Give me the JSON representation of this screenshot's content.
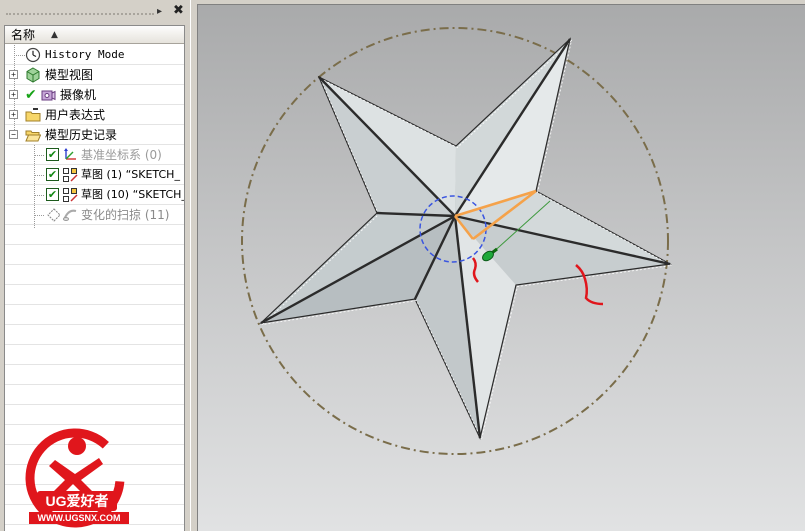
{
  "navigator": {
    "pin_glyph": "▸",
    "close_glyph": "✖",
    "column_header": "名称",
    "sort_glyph": "▲",
    "items": [
      {
        "label": "History Mode",
        "icon": "clock-icon"
      },
      {
        "label": "模型视图",
        "icon": "model-views-icon"
      },
      {
        "label": "摄像机",
        "icon": "cameras-icon"
      },
      {
        "label": "用户表达式",
        "icon": "folder-icon"
      },
      {
        "label": "模型历史记录",
        "icon": "folder-open-icon"
      },
      {
        "label": "基准坐标系 (0)",
        "icon": "datum-csys-icon"
      },
      {
        "label": "草图 (1) “SKETCH_",
        "icon": "sketch-icon"
      },
      {
        "label": "草图 (10) “SKETCH_",
        "icon": "sketch-icon"
      },
      {
        "label": "变化的扫掠 (11)",
        "icon": "variational-sweep-icon"
      }
    ],
    "expand_glyph": "+",
    "collapse_glyph": "−",
    "check_glyph": "✔"
  },
  "logo": {
    "brand": "UG爱好者",
    "url": "WWW.UGSNX.COM"
  },
  "colors": {
    "accent_red": "#e0161c",
    "selection_orange": "#f5a24a",
    "circle_dash": "#7a6d4a"
  }
}
